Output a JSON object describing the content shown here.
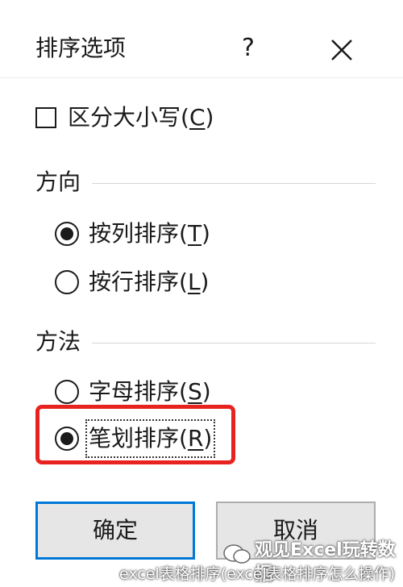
{
  "window": {
    "title": "排序选项",
    "help_label": "?",
    "close_icon": "close-icon"
  },
  "case_sensitive": {
    "label": "区分大小写(",
    "mnemonic": "C",
    "suffix": ")",
    "checked": false
  },
  "orientation": {
    "label": "方向",
    "options": [
      {
        "label": "按列排序(",
        "mnemonic": "T",
        "suffix": ")",
        "selected": true
      },
      {
        "label": "按行排序(",
        "mnemonic": "L",
        "suffix": ")",
        "selected": false
      }
    ]
  },
  "method": {
    "label": "方法",
    "options": [
      {
        "label": "字母排序(",
        "mnemonic": "S",
        "suffix": ")",
        "selected": false
      },
      {
        "label": "笔划排序(",
        "mnemonic": "R",
        "suffix": ")",
        "selected": true
      }
    ]
  },
  "buttons": {
    "ok": "确定",
    "cancel": "取消"
  },
  "watermark": {
    "line1": "观见Excel玩转数据",
    "line2": "excel表格排序(excel表格排序怎么操作)"
  },
  "colors": {
    "highlight": "#e8231f",
    "primary_border": "#0078d7"
  }
}
